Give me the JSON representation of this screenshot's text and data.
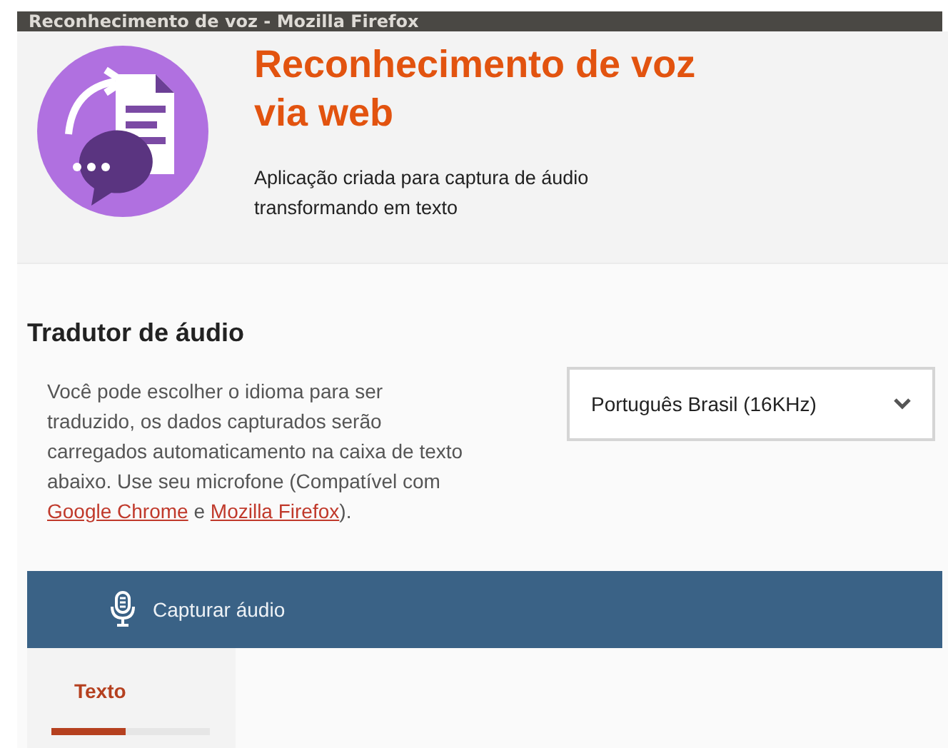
{
  "window": {
    "title": "Reconhecimento de voz - Mozilla Firefox"
  },
  "header": {
    "title_lines": [
      "Reconhecimento de voz",
      "via web"
    ],
    "subtitle_lines": [
      "Aplicação criada para captura de áudio",
      "transformando em texto"
    ]
  },
  "section": {
    "title": "Tradutor de áudio",
    "description": [
      {
        "kind": "text",
        "text": "Você pode escolher o idioma para ser traduzido, os dados capturados serão carregados automaticamento na caixa de texto abaixo. Use seu microfone (Compatível com "
      },
      {
        "kind": "link",
        "text": "Google Chrome"
      },
      {
        "kind": "text",
        "text": " e "
      },
      {
        "kind": "link",
        "text": "Mozilla Firefox"
      },
      {
        "kind": "text",
        "text": ")."
      }
    ],
    "language_select": {
      "value": "Português Brasil (16KHz)"
    }
  },
  "capture_button": {
    "label": "Capturar áudio"
  },
  "tabs": [
    {
      "label": "Texto",
      "selected": true,
      "level": 0.47
    }
  ]
}
